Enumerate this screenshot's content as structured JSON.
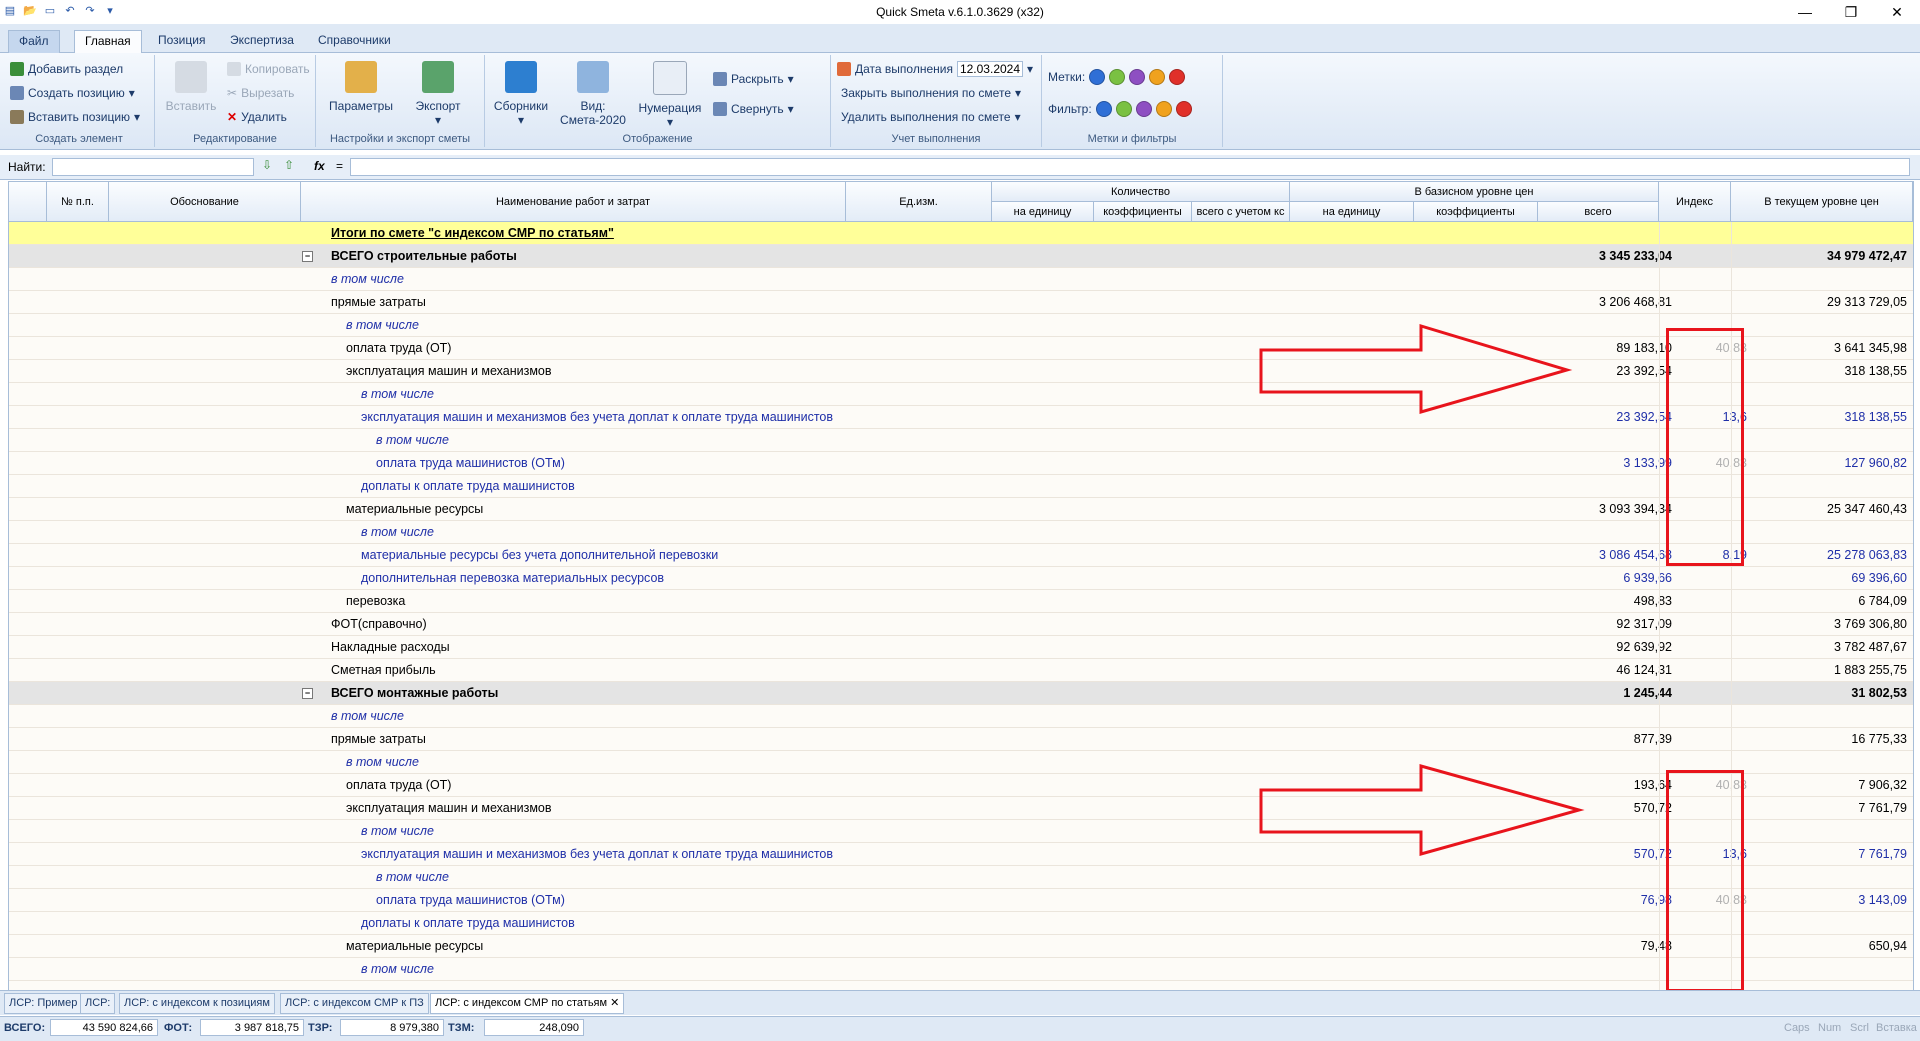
{
  "window": {
    "title": "Quick Smeta v.6.1.0.3629 (x32)"
  },
  "ribbon_tabs": [
    "Файл",
    "Главная",
    "Позиция",
    "Экспертиза",
    "Справочники"
  ],
  "ribbon": {
    "create": {
      "add_section": "Добавить раздел",
      "create_position": "Создать позицию",
      "insert_position": "Вставить позицию",
      "label": "Создать элемент"
    },
    "edit": {
      "paste": "Вставить",
      "copy": "Копировать",
      "cut": "Вырезать",
      "delete": "Удалить",
      "label": "Редактирование"
    },
    "settings": {
      "params": "Параметры",
      "export": "Экспорт",
      "label": "Настройки и экспорт сметы"
    },
    "display": {
      "collections": "Сборники",
      "view": "Вид:",
      "view_value": "Смета-2020",
      "numbering": "Нумерация",
      "expand": "Раскрыть",
      "collapse": "Свернуть",
      "label": "Отображение"
    },
    "execution": {
      "date_label": "Дата выполнения",
      "date_value": "12.03.2024",
      "close": "Закрыть выполнения по смете",
      "delete": "Удалить выполнения по смете",
      "label": "Учет выполнения"
    },
    "marks": {
      "marks_label": "Метки:",
      "filter_label": "Фильтр:",
      "label": "Метки и фильтры"
    }
  },
  "findbar": {
    "label": "Найти:",
    "fx": "fx",
    "eq": "="
  },
  "columns": {
    "num": "№ п.п.",
    "basis": "Обоснование",
    "name": "Наименование работ и затрат",
    "unit": "Ед.изм.",
    "qty": "Количество",
    "qty_unit": "на единицу",
    "qty_coef": "коэффициенты",
    "qty_total": "всего с учетом кс",
    "base": "В базисном уровне цен",
    "base_unit": "на единицу",
    "base_coef": "коэффициенты",
    "base_total": "всего",
    "index": "Индекс",
    "current": "В текущем уровне цен"
  },
  "rows": [
    {
      "name": "Итоги по смете \"с индексом СМР по статьям\"",
      "base": "",
      "index": "",
      "current": ""
    },
    {
      "name": "ВСЕГО строительные работы",
      "base": "3 345 233,04",
      "index": "",
      "current": "34 979 472,47"
    },
    {
      "name": "в том числе",
      "base": "",
      "index": "",
      "current": ""
    },
    {
      "name": "прямые затраты",
      "base": "3 206 468,81",
      "index": "",
      "current": "29 313 729,05"
    },
    {
      "name": "в том числе",
      "base": "",
      "index": "",
      "current": ""
    },
    {
      "name": "оплата труда (ОТ)",
      "base": "89 183,10",
      "index": "40,83",
      "current": "3 641 345,98"
    },
    {
      "name": "эксплуатация машин и механизмов",
      "base": "23 392,54",
      "index": "",
      "current": "318 138,55"
    },
    {
      "name": "в том числе",
      "base": "",
      "index": "",
      "current": ""
    },
    {
      "name": "эксплуатация машин и механизмов без учета доплат к оплате труда машинистов",
      "base": "23 392,54",
      "index": "13,6",
      "current": "318 138,55"
    },
    {
      "name": "в том числе",
      "base": "",
      "index": "",
      "current": ""
    },
    {
      "name": "оплата труда машинистов (ОТм)",
      "base": "3 133,99",
      "index": "40,83",
      "current": "127 960,82"
    },
    {
      "name": "доплаты к оплате труда машинистов",
      "base": "",
      "index": "",
      "current": ""
    },
    {
      "name": "материальные ресурсы",
      "base": "3 093 394,34",
      "index": "",
      "current": "25 347 460,43"
    },
    {
      "name": "в том числе",
      "base": "",
      "index": "",
      "current": ""
    },
    {
      "name": "материальные ресурсы без учета дополнительной перевозки",
      "base": "3 086 454,68",
      "index": "8,19",
      "current": "25 278 063,83"
    },
    {
      "name": "дополнительная перевозка материальных ресурсов",
      "base": "6 939,66",
      "index": "",
      "current": "69 396,60"
    },
    {
      "name": "перевозка",
      "base": "498,83",
      "index": "",
      "current": "6 784,09"
    },
    {
      "name": "ФОТ(справочно)",
      "base": "92 317,09",
      "index": "",
      "current": "3 769 306,80"
    },
    {
      "name": "Накладные расходы",
      "base": "92 639,92",
      "index": "",
      "current": "3 782 487,67"
    },
    {
      "name": "Сметная прибыль",
      "base": "46 124,31",
      "index": "",
      "current": "1 883 255,75"
    },
    {
      "name": "ВСЕГО монтажные работы",
      "base": "1 245,44",
      "index": "",
      "current": "31 802,53"
    },
    {
      "name": "в том числе",
      "base": "",
      "index": "",
      "current": ""
    },
    {
      "name": "прямые затраты",
      "base": "877,39",
      "index": "",
      "current": "16 775,33"
    },
    {
      "name": "в том числе",
      "base": "",
      "index": "",
      "current": ""
    },
    {
      "name": "оплата труда (ОТ)",
      "base": "193,64",
      "index": "40,83",
      "current": "7 906,32"
    },
    {
      "name": "эксплуатация машин и механизмов",
      "base": "570,72",
      "index": "",
      "current": "7 761,79"
    },
    {
      "name": "в том числе",
      "base": "",
      "index": "",
      "current": ""
    },
    {
      "name": "эксплуатация машин и механизмов без учета доплат к оплате труда машинистов",
      "base": "570,72",
      "index": "13,6",
      "current": "7 761,79"
    },
    {
      "name": "в том числе",
      "base": "",
      "index": "",
      "current": ""
    },
    {
      "name": "оплата труда машинистов (ОТм)",
      "base": "76,98",
      "index": "40,83",
      "current": "3 143,09"
    },
    {
      "name": "доплаты к оплате труда машинистов",
      "base": "",
      "index": "",
      "current": ""
    },
    {
      "name": "материальные ресурсы",
      "base": "79,48",
      "index": "",
      "current": "650,94"
    },
    {
      "name": "в том числе",
      "base": "",
      "index": "",
      "current": ""
    }
  ],
  "sheet_tabs": [
    "ЛСР: Пример",
    "ЛСР:",
    "ЛСР: с индексом к позициям",
    "ЛСР: с индексом СМР к ПЗ",
    "ЛСР: с индексом СМР по статьям"
  ],
  "status": {
    "total_label": "ВСЕГО:",
    "total": "43 590 824,66",
    "fot_label": "ФОТ:",
    "fot": "3 987 818,75",
    "tzr_label": "ТЗР:",
    "tzr": "8 979,380",
    "tzm_label": "ТЗМ:",
    "tzm": "248,090",
    "indicators": [
      "Caps",
      "Num",
      "Scrl",
      "Вставка"
    ]
  },
  "colors": {
    "accent": "#1f2fa8",
    "highlight_border": "#e8141c",
    "total_row": "#ffff99",
    "group_row": "#e4e4e4"
  }
}
